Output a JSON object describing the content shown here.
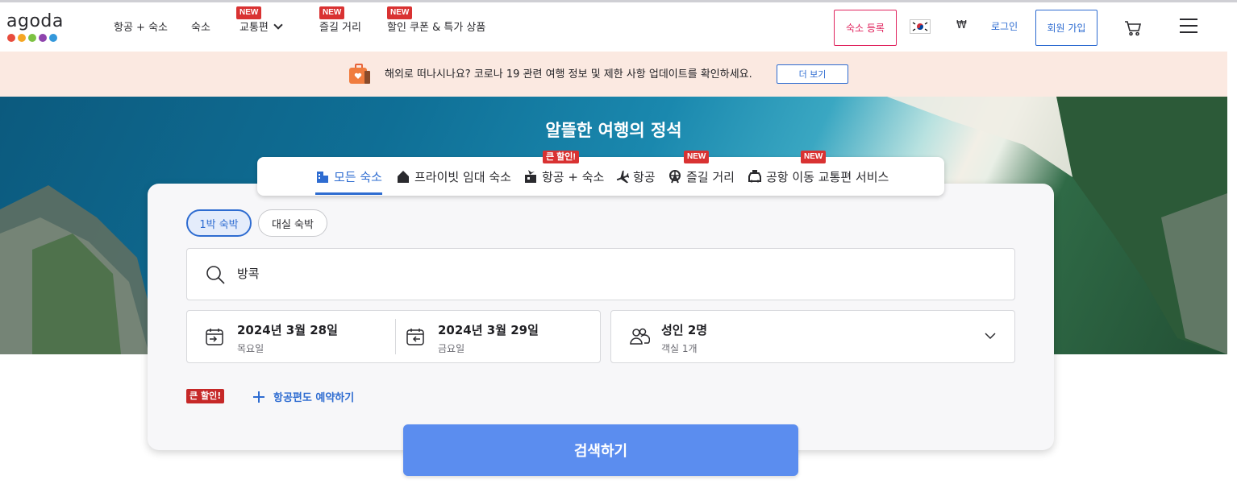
{
  "header": {
    "logo_text": "agoda",
    "logo_colors": [
      "#e84c3d",
      "#f5a623",
      "#7cc242",
      "#8e44ad",
      "#3498db"
    ],
    "nav": {
      "flights_hotels": "항공 + 숙소",
      "stays": "숙소",
      "transport": "교통편",
      "activities": "즐길 거리",
      "deals": "할인 쿠폰 & 특가 상품"
    },
    "new_badge": "NEW",
    "list_property": "숙소 등록",
    "currency": "₩",
    "login": "로그인",
    "signup": "회원 가입"
  },
  "notice": {
    "text": "해외로 떠나시나요? 코로나 19 관련 여행 정보 및 제한 사항 업데이트를 확인하세요.",
    "more": "더 보기"
  },
  "hero": {
    "title": "알뜰한 여행의 정석"
  },
  "tabs": {
    "all_stays": "모든 숙소",
    "private": "프라이빗 임대 숙소",
    "flight_hotel": "항공 + 숙소",
    "flights": "항공",
    "activities": "즐길 거리",
    "airport_transfer": "공항 이동 교통편 서비스",
    "big_discount": "큰 할인!",
    "new_badge": "NEW"
  },
  "search": {
    "overnight": "1박 숙박",
    "dayuse": "대실 숙박",
    "destination": "방콕",
    "checkin_date": "2024년 3월 28일",
    "checkin_day": "목요일",
    "checkout_date": "2024년 3월 29일",
    "checkout_day": "금요일",
    "guests": "성인 2명",
    "rooms": "객실 1개",
    "big_discount": "큰 할인!",
    "add_flight": "항공편도 예약하기",
    "submit": "검색하기"
  }
}
